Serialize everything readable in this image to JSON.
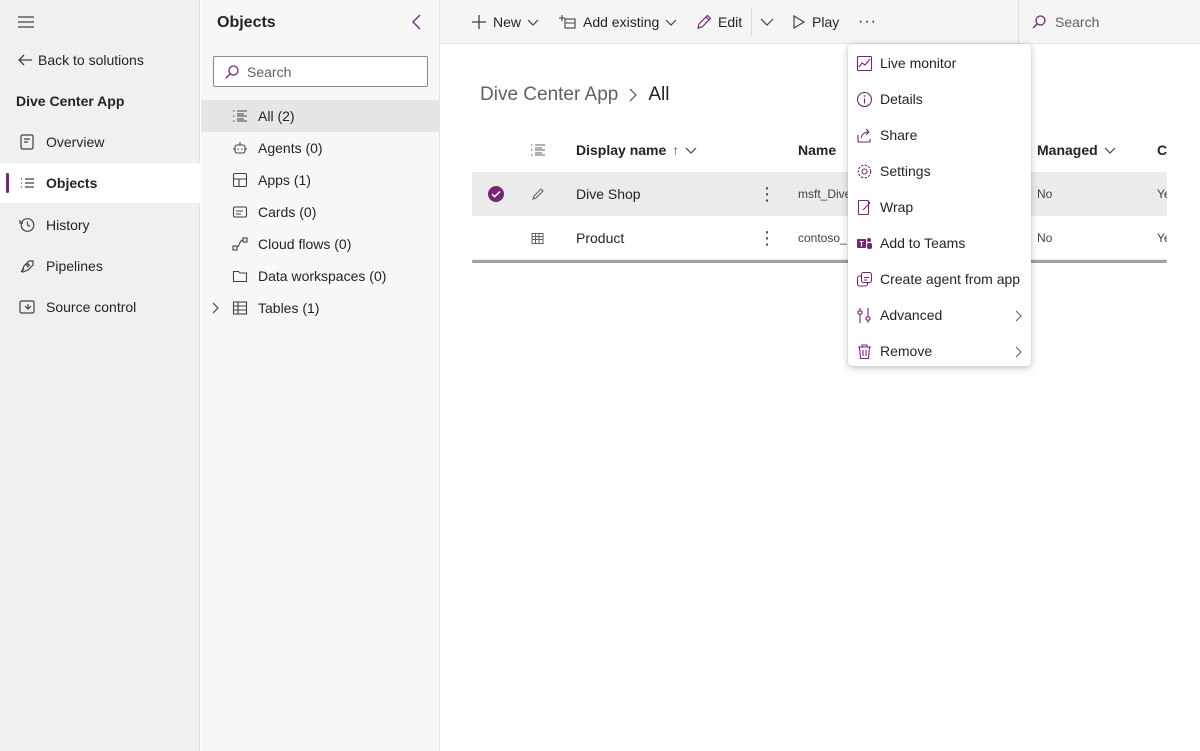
{
  "nav": {
    "back_label": "Back to solutions",
    "app_name": "Dive Center App",
    "items": [
      {
        "label": "Overview",
        "icon": "overview-icon"
      },
      {
        "label": "Objects",
        "icon": "objects-icon",
        "active": true
      },
      {
        "label": "History",
        "icon": "history-icon"
      },
      {
        "label": "Pipelines",
        "icon": "pipelines-icon"
      },
      {
        "label": "Source control",
        "icon": "source-control-icon"
      }
    ]
  },
  "objects_pane": {
    "title": "Objects",
    "search_placeholder": "Search",
    "items": [
      {
        "label": "All",
        "count": "(2)",
        "icon": "list-icon",
        "active": true
      },
      {
        "label": "Agents",
        "count": "(0)",
        "icon": "agent-icon"
      },
      {
        "label": "Apps",
        "count": "(1)",
        "icon": "apps-icon"
      },
      {
        "label": "Cards",
        "count": "(0)",
        "icon": "cards-icon"
      },
      {
        "label": "Cloud flows",
        "count": "(0)",
        "icon": "flow-icon"
      },
      {
        "label": "Data workspaces",
        "count": "(0)",
        "icon": "folder-icon"
      },
      {
        "label": "Tables",
        "count": "(1)",
        "icon": "table-icon",
        "expandable": true
      }
    ]
  },
  "toolbar": {
    "new_label": "New",
    "add_existing_label": "Add existing",
    "edit_label": "Edit",
    "play_label": "Play",
    "more_label": "···",
    "search_placeholder": "Search"
  },
  "breadcrumb": {
    "parent": "Dive Center App",
    "current": "All"
  },
  "table": {
    "columns": {
      "display_name": "Display name",
      "sort_arrow": "↑",
      "name": "Name",
      "managed": "Managed",
      "extra": "C"
    },
    "rows": [
      {
        "display_name": "Dive Shop",
        "name": "msft_Dive",
        "managed": "No",
        "extra": "Ye",
        "selected": true,
        "icon": "pencil-icon"
      },
      {
        "display_name": "Product",
        "name": "contoso_",
        "managed": "No",
        "extra": "Ye",
        "selected": false,
        "icon": "table-icon"
      }
    ]
  },
  "context_menu": {
    "items": [
      {
        "label": "Live monitor",
        "icon": "live-monitor-icon"
      },
      {
        "label": "Details",
        "icon": "info-icon"
      },
      {
        "label": "Share",
        "icon": "share-icon"
      },
      {
        "label": "Settings",
        "icon": "gear-icon"
      },
      {
        "label": "Wrap",
        "icon": "wrap-icon"
      },
      {
        "label": "Add to Teams",
        "icon": "teams-icon"
      },
      {
        "label": "Create agent from app",
        "icon": "create-agent-icon"
      },
      {
        "label": "Advanced",
        "icon": "advanced-icon",
        "submenu": true
      },
      {
        "label": "Remove",
        "icon": "trash-icon",
        "submenu": true
      }
    ]
  },
  "colors": {
    "accent": "#742774",
    "nav_bg": "#f0f0f0",
    "selected_row": "#ebebeb"
  }
}
